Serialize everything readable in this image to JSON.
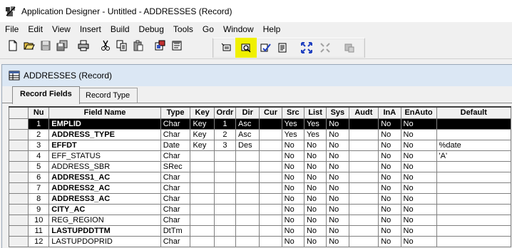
{
  "titlebar": {
    "title": "Application Designer - Untitled - ADDRESSES (Record)"
  },
  "menu": [
    "File",
    "Edit",
    "View",
    "Insert",
    "Build",
    "Debug",
    "Tools",
    "Go",
    "Window",
    "Help"
  ],
  "toolbar": {
    "icons": [
      "new-icon",
      "open-icon",
      "save-icon",
      "save-all-icon",
      "print-icon",
      "cut-icon",
      "copy-icon",
      "paste-icon",
      "project-icon",
      "properties-icon",
      "insert-field-icon",
      "find-definition-references-icon",
      "validate-icon",
      "sql-icon",
      "expand-all-icon",
      "collapse-all-icon",
      "build-icon"
    ],
    "highlight_color": "#f0f000"
  },
  "document": {
    "title": "ADDRESSES (Record)",
    "tabs": [
      "Record Fields",
      "Record Type"
    ],
    "active_tab": "Record Fields"
  },
  "grid": {
    "columns": [
      "Nu",
      "Field Name",
      "Type",
      "Key",
      "Ordr",
      "Dir",
      "Cur",
      "Src",
      "List",
      "Sys",
      "Audt",
      "InA",
      "EnAuto",
      "Default"
    ],
    "rows": [
      {
        "num": "1",
        "name": "EMPLID",
        "type": "Char",
        "key": "Key",
        "ordr": "1",
        "dir": "Asc",
        "cur": "",
        "src": "Yes",
        "list": "Yes",
        "sys": "No",
        "audt": "",
        "ina": "No",
        "enauto": "No",
        "default": "",
        "bold": true,
        "selected": true
      },
      {
        "num": "2",
        "name": "ADDRESS_TYPE",
        "type": "Char",
        "key": "Key",
        "ordr": "2",
        "dir": "Asc",
        "cur": "",
        "src": "Yes",
        "list": "Yes",
        "sys": "No",
        "audt": "",
        "ina": "No",
        "enauto": "No",
        "default": "",
        "bold": true,
        "selected": false
      },
      {
        "num": "3",
        "name": "EFFDT",
        "type": "Date",
        "key": "Key",
        "ordr": "3",
        "dir": "Des",
        "cur": "",
        "src": "No",
        "list": "No",
        "sys": "No",
        "audt": "",
        "ina": "No",
        "enauto": "No",
        "default": "%date",
        "bold": true,
        "selected": false
      },
      {
        "num": "4",
        "name": "EFF_STATUS",
        "type": "Char",
        "key": "",
        "ordr": "",
        "dir": "",
        "cur": "",
        "src": "No",
        "list": "No",
        "sys": "No",
        "audt": "",
        "ina": "No",
        "enauto": "No",
        "default": "'A'",
        "bold": false,
        "selected": false
      },
      {
        "num": "5",
        "name": "ADDRESS_SBR",
        "type": "SRec",
        "key": "",
        "ordr": "",
        "dir": "",
        "cur": "",
        "src": "No",
        "list": "No",
        "sys": "No",
        "audt": "",
        "ina": "No",
        "enauto": "No",
        "default": "",
        "bold": false,
        "selected": false
      },
      {
        "num": "6",
        "name": "ADDRESS1_AC",
        "type": "Char",
        "key": "",
        "ordr": "",
        "dir": "",
        "cur": "",
        "src": "No",
        "list": "No",
        "sys": "No",
        "audt": "",
        "ina": "No",
        "enauto": "No",
        "default": "",
        "bold": true,
        "selected": false
      },
      {
        "num": "7",
        "name": "ADDRESS2_AC",
        "type": "Char",
        "key": "",
        "ordr": "",
        "dir": "",
        "cur": "",
        "src": "No",
        "list": "No",
        "sys": "No",
        "audt": "",
        "ina": "No",
        "enauto": "No",
        "default": "",
        "bold": true,
        "selected": false
      },
      {
        "num": "8",
        "name": "ADDRESS3_AC",
        "type": "Char",
        "key": "",
        "ordr": "",
        "dir": "",
        "cur": "",
        "src": "No",
        "list": "No",
        "sys": "No",
        "audt": "",
        "ina": "No",
        "enauto": "No",
        "default": "",
        "bold": true,
        "selected": false
      },
      {
        "num": "9",
        "name": "CITY_AC",
        "type": "Char",
        "key": "",
        "ordr": "",
        "dir": "",
        "cur": "",
        "src": "No",
        "list": "No",
        "sys": "No",
        "audt": "",
        "ina": "No",
        "enauto": "No",
        "default": "",
        "bold": true,
        "selected": false
      },
      {
        "num": "10",
        "name": "REG_REGION",
        "type": "Char",
        "key": "",
        "ordr": "",
        "dir": "",
        "cur": "",
        "src": "No",
        "list": "No",
        "sys": "No",
        "audt": "",
        "ina": "No",
        "enauto": "No",
        "default": "",
        "bold": false,
        "selected": false
      },
      {
        "num": "11",
        "name": "LASTUPDDTTM",
        "type": "DtTm",
        "key": "",
        "ordr": "",
        "dir": "",
        "cur": "",
        "src": "No",
        "list": "No",
        "sys": "No",
        "audt": "",
        "ina": "No",
        "enauto": "No",
        "default": "",
        "bold": true,
        "selected": false
      },
      {
        "num": "12",
        "name": "LASTUPDOPRID",
        "type": "Char",
        "key": "",
        "ordr": "",
        "dir": "",
        "cur": "",
        "src": "No",
        "list": "No",
        "sys": "No",
        "audt": "",
        "ina": "No",
        "enauto": "No",
        "default": "",
        "bold": false,
        "selected": false
      }
    ]
  }
}
